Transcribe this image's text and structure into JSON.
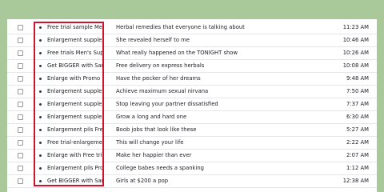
{
  "emails": [
    {
      "sender": "Free trial sample Me",
      "subject": "Herbal remedies that everyone is talking about",
      "time": "11:23 AM"
    },
    {
      "sender": "Enlargement supple",
      "subject": "She revealed herself to me",
      "time": "10:46 AM"
    },
    {
      "sender": "Free trials Men's Sup",
      "subject": "What really happened on the TONIGHT show",
      "time": "10:26 AM"
    },
    {
      "sender": "Get BIGGER with Sar",
      "subject": "Free delivery on express herbals",
      "time": "10:08 AM"
    },
    {
      "sender": "Enlarge with Promo",
      "subject": "Have the pecker of her dreams",
      "time": "9:48 AM"
    },
    {
      "sender": "Enlargement supple",
      "subject": "Achieve maximum sexual nirvana",
      "time": "7:50 AM"
    },
    {
      "sender": "Enlargement supple",
      "subject": "Stop leaving your partner dissatisfied",
      "time": "7:37 AM"
    },
    {
      "sender": "Enlargement supple",
      "subject": "Grow a long and hard one",
      "time": "6:30 AM"
    },
    {
      "sender": "Enlargement pils Fre",
      "subject": "Boob jobs that look like these",
      "time": "5:27 AM"
    },
    {
      "sender": "Free trial-enlargeme",
      "subject": "This will change your life",
      "time": "2:22 AM"
    },
    {
      "sender": "Enlarge with Free tri",
      "subject": "Make her happier than ever",
      "time": "2:07 AM"
    },
    {
      "sender": "Enlargement pils Pro",
      "subject": "College babes needs a spanking",
      "time": "1:12 AM"
    },
    {
      "sender": "Get BIGGER with Sar",
      "subject": "Girls at $200 a pop",
      "time": "12:38 AM"
    }
  ],
  "colors": {
    "highlight": "#d0142b",
    "unread_dot": "#2e2a8a",
    "background": "#a9c99a"
  }
}
